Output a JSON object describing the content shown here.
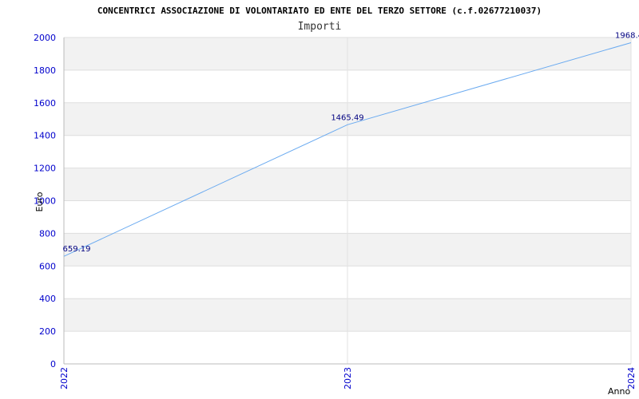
{
  "chart_data": {
    "type": "line",
    "title": "CONCENTRICI ASSOCIAZIONE DI VOLONTARIATO ED ENTE DEL TERZO SETTORE (c.f.02677210037)",
    "subtitle": "Importi",
    "xlabel": "Anno",
    "ylabel": "Euro",
    "x": [
      "2022",
      "2023",
      "2024"
    ],
    "series": [
      {
        "values": [
          659.19,
          1465.49,
          1968.4
        ]
      }
    ],
    "data_labels": [
      "659.19",
      "1465.49",
      "1968.4"
    ],
    "yticks": [
      "0",
      "200",
      "400",
      "600",
      "800",
      "1000",
      "1200",
      "1400",
      "1600",
      "1800",
      "2000"
    ],
    "ylim": [
      0,
      2000
    ],
    "grid": true,
    "line_color": "#6aaaf0",
    "band_color": "#f2f2f2",
    "tick_color": "#0000cc"
  }
}
